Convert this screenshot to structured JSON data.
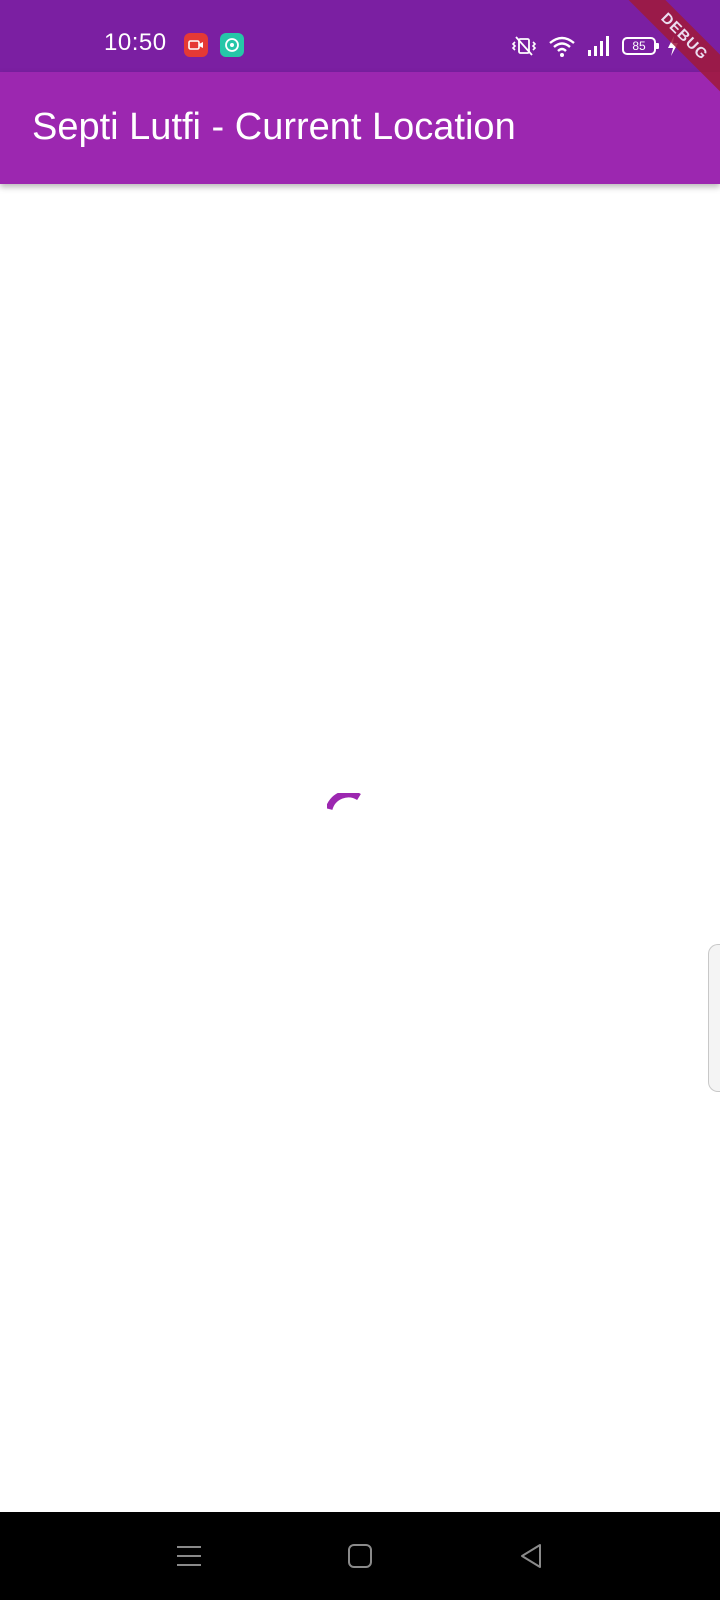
{
  "status_bar": {
    "time": "10:50",
    "battery_level": "85",
    "icons": [
      "screen-record-icon",
      "app-notification-icon",
      "vibrate-icon",
      "wifi-icon",
      "cellular-signal-icon",
      "battery-icon",
      "charging-icon"
    ]
  },
  "app_bar": {
    "title": "Septi Lutfi - Current Location"
  },
  "debug_banner": {
    "label": "DEBUG"
  },
  "content": {
    "state": "loading"
  },
  "nav_bar": {
    "buttons": [
      "menu-icon",
      "home-icon",
      "back-icon"
    ]
  },
  "colors": {
    "status_bar": "#7b1fa2",
    "app_bar": "#9c27b0",
    "spinner": "#9c27b0",
    "debug_banner": "#a01a3a",
    "nav_bar": "#000000"
  }
}
